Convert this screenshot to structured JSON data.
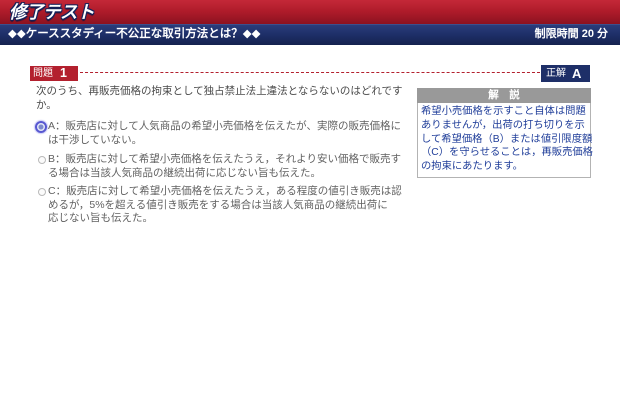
{
  "header": {
    "title": "修了テスト"
  },
  "section_bar": {
    "title": "◆◆ケーススタディー不公正な取引方法とは？◆◆",
    "time_limit": "制限時間 20 分"
  },
  "question": {
    "label": "問題",
    "number": "1",
    "text_lines": [
      "次のうち、再販売価格の拘束として独占禁止法上違法とならないのはどれです",
      "か。"
    ],
    "options": [
      {
        "checked": true,
        "lines": [
          "A：販売店に対して人気商品の希望小売価格を伝えたが、実際の販売価格に",
          "は干渉していない。"
        ]
      },
      {
        "checked": false,
        "lines": [
          "B：販売店に対して希望小売価格を伝えたうえ，それより安い価格で販売す",
          "る場合は当該人気商品の継続出荷に応じない旨も伝えた。"
        ]
      },
      {
        "checked": false,
        "lines": [
          "C：販売店に対して希望小売価格を伝えたうえ，ある程度の値引き販売は認",
          "めるが，5%を超える値引き販売をする場合は当該人気商品の継続出荷に",
          "応じない旨も伝えた。"
        ]
      }
    ]
  },
  "answer": {
    "label": "正解",
    "value": "A"
  },
  "explanation": {
    "title": "解　説",
    "lines": [
      "希望小売価格を示すこと自体は問題",
      "ありませんが，出荷の打ち切りを示",
      "して希望価格（B）または値引限度額",
      "（C）を守らせることは，再販売価格",
      "の拘束にあたります。"
    ]
  },
  "theme": {
    "colors": {
      "header-red": "#b01c2b",
      "navy": "#1e2f68",
      "label-red": "#b3202e",
      "answer-navy": "#1e2f68",
      "explain-text": "#1f3d99",
      "explain-head": "#999999",
      "radio-selected": "#5757d1"
    }
  }
}
